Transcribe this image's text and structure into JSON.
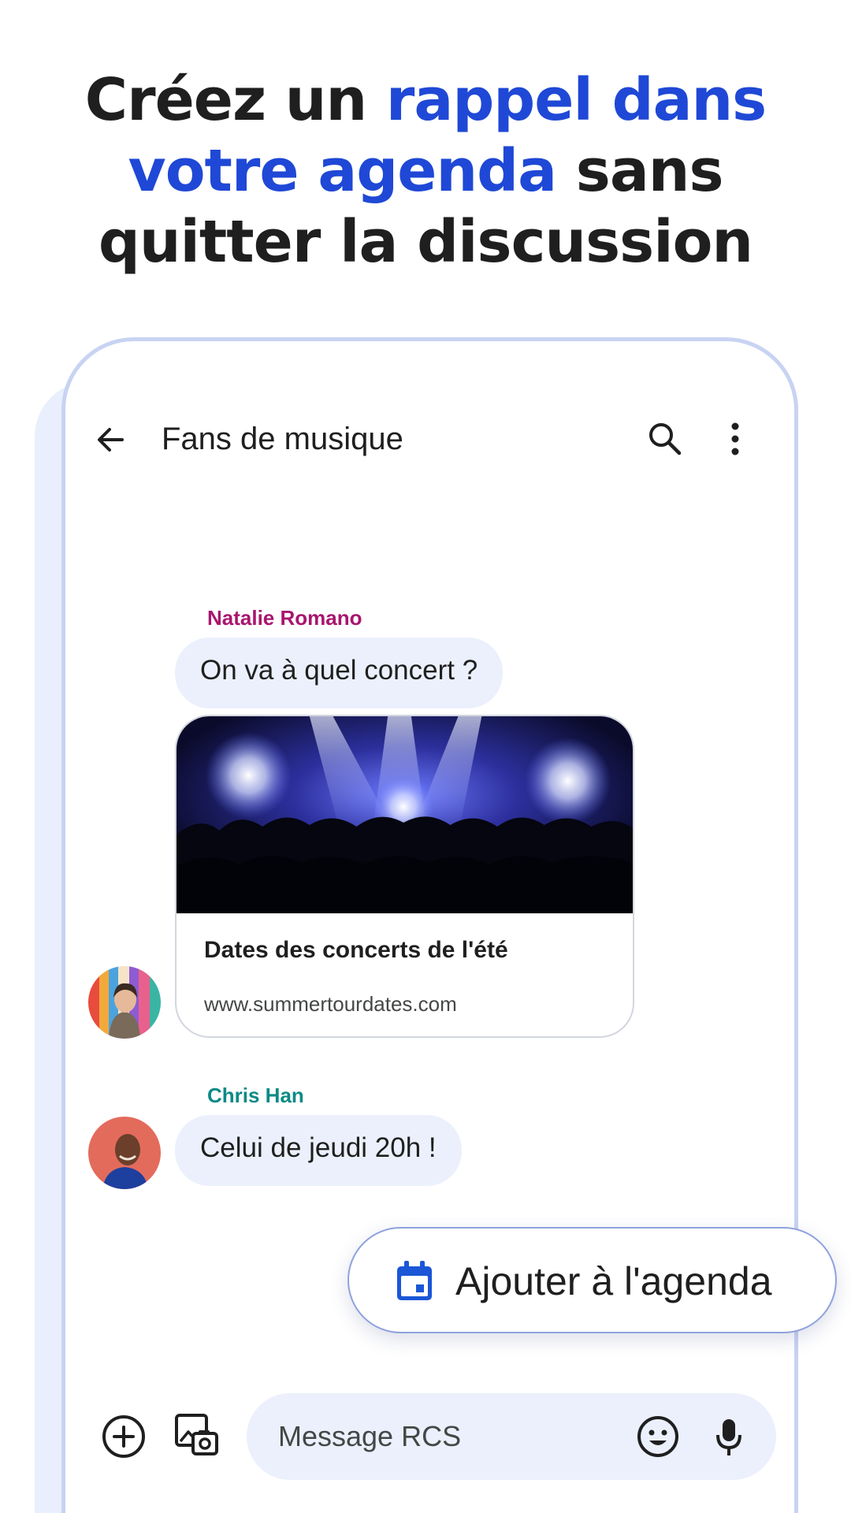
{
  "headline": {
    "part1": "Créez un ",
    "accent": "rappel dans votre agenda",
    "part2": " sans quitter la discussion"
  },
  "conversation": {
    "title": "Fans de musique",
    "messages": [
      {
        "sender": "Natalie Romano",
        "text": "On va à quel concert ?"
      },
      {
        "sender": "Chris Han",
        "text": "Celui de jeudi 20h !"
      }
    ],
    "link_card": {
      "title": "Dates des concerts de l'été",
      "url": "www.summertourdates.com"
    }
  },
  "compose": {
    "placeholder": "Message RCS"
  },
  "action_chip": {
    "label": "Ajouter à l'agenda"
  },
  "colors": {
    "accent": "#1f48d6",
    "natalie_name": "#a8166e",
    "chris_name": "#0b8a86",
    "bubble": "#ebf0fc",
    "calendar_icon": "#1a56d6"
  },
  "icons": [
    "back-arrow-icon",
    "search-icon",
    "more-vert-icon",
    "add-circle-icon",
    "gallery-icon",
    "emoji-icon",
    "mic-icon",
    "calendar-icon"
  ]
}
